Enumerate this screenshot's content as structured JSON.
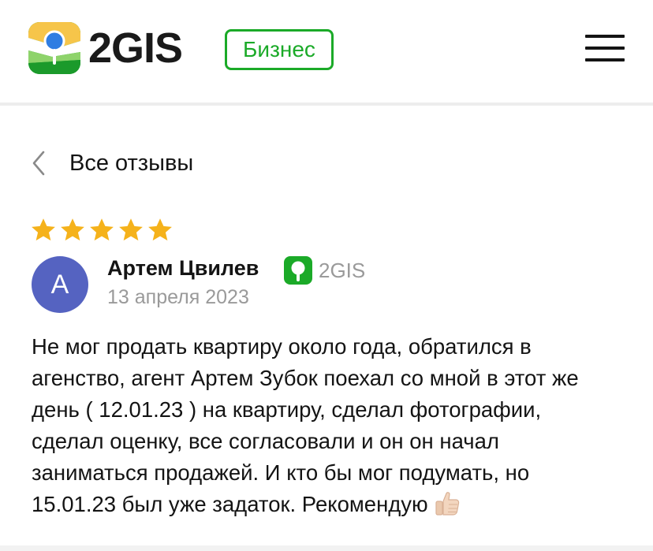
{
  "header": {
    "logo_text": "2GIS",
    "logo_icon": "2gis-logo-icon",
    "business_label": "Бизнес",
    "menu_icon": "hamburger-menu-icon"
  },
  "navigation": {
    "back_label": "Все отзывы",
    "back_icon": "chevron-left-icon"
  },
  "review": {
    "rating": 5,
    "max_rating": 5,
    "author": {
      "avatar_initial": "A",
      "name": "Артем Цвилев",
      "avatar_color": "#5563c1"
    },
    "source": {
      "label": "2GIS",
      "icon": "2gis-badge-icon"
    },
    "date": "13 апреля 2023",
    "text_lines": [
      "Не мог продать квартиру около года, обратился в",
      "агенство, агент Артем Зубок поехал со мной в этот же",
      "день ( 12.01.23 ) на квартиру, сделал фотографии,",
      "сделал оценку, все согласовали и он он начал",
      "заниматься продажей. И кто бы мог подумать, но",
      "15.01.23 был уже задаток. Рекомендую"
    ],
    "trailing_icon": "thumbs-up-icon"
  },
  "colors": {
    "brand_green": "#1baa28",
    "star_yellow": "#f5b21b",
    "muted_text": "#9a9a9a"
  }
}
